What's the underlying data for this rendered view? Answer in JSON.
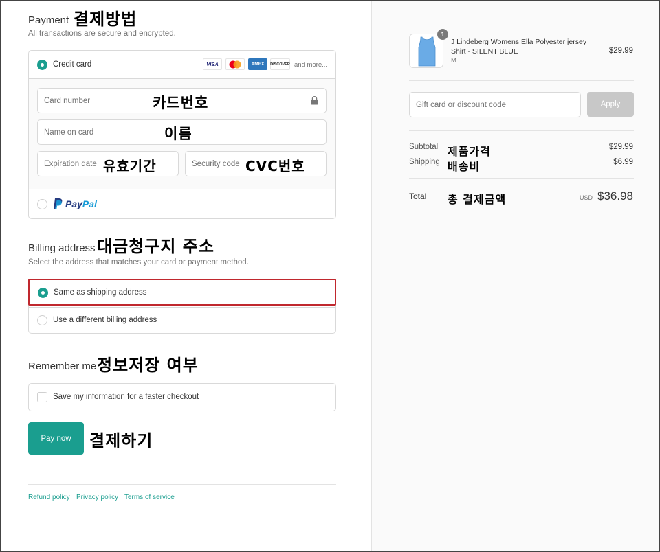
{
  "payment": {
    "title": "Payment",
    "title_ko": "결제방법",
    "subtitle": "All transactions are secure and encrypted.",
    "credit_card_label": "Credit card",
    "card_brands": [
      "VISA",
      "MC",
      "AMEX",
      "DISCOVER"
    ],
    "more_label": "and more...",
    "card_number_placeholder": "Card number",
    "card_number_ko": "카드번호",
    "name_placeholder": "Name on card",
    "name_ko": "이름",
    "expiration_placeholder": "Expiration date",
    "expiration_ko": "유효기간",
    "security_placeholder": "Security code",
    "security_ko": "CVC번호",
    "paypal_pay": "Pay",
    "paypal_pal": "Pal"
  },
  "billing": {
    "title": "Billing address",
    "title_ko": "대금청구지 주소",
    "subtitle": "Select the address that matches your card or payment method.",
    "same_label": "Same as shipping address",
    "different_label": "Use a different billing address"
  },
  "remember": {
    "title": "Remember me",
    "title_ko": "정보저장 여부",
    "save_label": "Save my information for a faster checkout"
  },
  "pay_button": {
    "label": "Pay now",
    "label_ko": "결제하기"
  },
  "footer": {
    "links": [
      "Refund policy",
      "Privacy policy",
      "Terms of service"
    ]
  },
  "order": {
    "item": {
      "quantity": "1",
      "name": "J Lindeberg Womens Ella Polyester jersey Shirt - SILENT BLUE",
      "variant": "M",
      "price": "$29.99"
    },
    "discount_placeholder": "Gift card or discount code",
    "apply_label": "Apply",
    "subtotal_label": "Subtotal",
    "subtotal_ko": "제품가격",
    "subtotal_value": "$29.99",
    "shipping_label": "Shipping",
    "shipping_ko": "배송비",
    "shipping_value": "$6.99",
    "total_label": "Total",
    "total_ko": "총 결제금액",
    "currency": "USD",
    "total_value": "$36.98"
  },
  "colors": {
    "accent": "#1a9e8f",
    "highlight_border": "#c0282e",
    "paypal_dark": "#253b80",
    "paypal_light": "#179bd7"
  }
}
